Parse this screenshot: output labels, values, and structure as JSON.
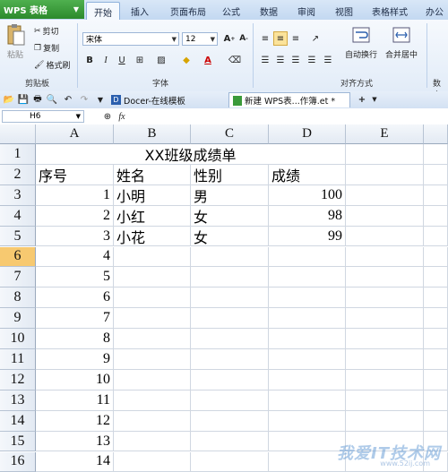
{
  "app": {
    "name": "WPS 表格"
  },
  "ribbon_tabs": [
    "开始",
    "插入",
    "页面布局",
    "公式",
    "数据",
    "审阅",
    "视图",
    "表格样式",
    "办公"
  ],
  "active_tab": "开始",
  "clipboard": {
    "paste": "粘贴",
    "cut": "剪切",
    "copy": "复制",
    "format_painter": "格式刷",
    "group": "剪贴板"
  },
  "font": {
    "name": "宋体",
    "size": "12",
    "group": "字体"
  },
  "alignment": {
    "wrap": "自动换行",
    "merge": "合并居中",
    "group": "对齐方式"
  },
  "number_group": "数字",
  "doc_tabs": [
    "Docer-在线模板",
    "新建 WPS表...作簿.et *"
  ],
  "namebox": "H6",
  "fx": "fx",
  "columns": [
    "A",
    "B",
    "C",
    "D",
    "E"
  ],
  "rows": [
    "1",
    "2",
    "3",
    "4",
    "5",
    "6",
    "7",
    "8",
    "9",
    "10",
    "11",
    "12",
    "13",
    "14",
    "15",
    "16"
  ],
  "selected_row": "6",
  "sheet": {
    "title": "XX班级成绩单",
    "headers": [
      "序号",
      "姓名",
      "性别",
      "成绩"
    ],
    "data": [
      [
        "1",
        "小明",
        "男",
        "100"
      ],
      [
        "2",
        "小红",
        "女",
        "98"
      ],
      [
        "3",
        "小花",
        "女",
        "99"
      ],
      [
        "4",
        "",
        "",
        ""
      ],
      [
        "5",
        "",
        "",
        ""
      ],
      [
        "6",
        "",
        "",
        ""
      ],
      [
        "7",
        "",
        "",
        ""
      ],
      [
        "8",
        "",
        "",
        ""
      ],
      [
        "9",
        "",
        "",
        ""
      ],
      [
        "10",
        "",
        "",
        ""
      ],
      [
        "11",
        "",
        "",
        ""
      ],
      [
        "12",
        "",
        "",
        ""
      ],
      [
        "13",
        "",
        "",
        ""
      ],
      [
        "14",
        "",
        "",
        ""
      ]
    ]
  },
  "watermark": {
    "text": "我爱IT技术网",
    "url": "www.52ij.com"
  }
}
